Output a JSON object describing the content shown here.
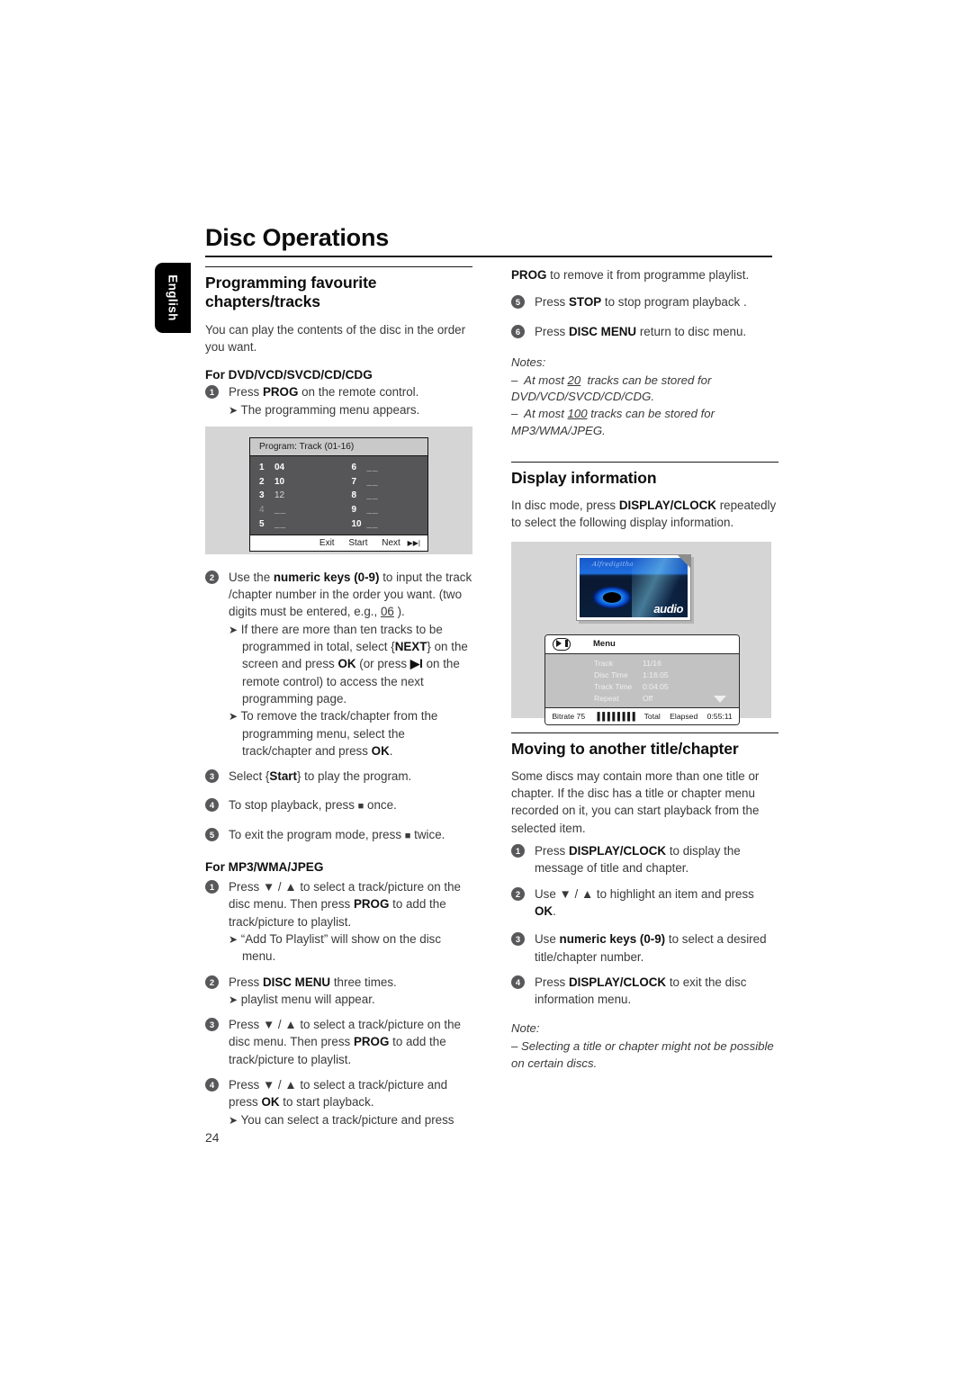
{
  "page": {
    "title": "Disc Operations",
    "language_tab": "English",
    "page_number": "24"
  },
  "left_column": {
    "section_heading": "Programming favourite chapters/tracks",
    "intro": "You can play the contents of the disc in the order you want.",
    "sub_head_1": "For DVD/VCD/SVCD/CD/CDG",
    "steps_dvd": [
      {
        "num": "1",
        "text_parts": [
          "Press ",
          "PROG",
          " on the remote control."
        ],
        "arrows": [
          "The programming menu appears."
        ]
      },
      {
        "num": "2",
        "text_parts": [
          "Use the ",
          "numeric keys (0-9)",
          " to input the track /chapter number in the order you want. (two digits must be entered, e.g., ",
          "06",
          " )."
        ],
        "arrows": [
          "If there are more than ten tracks to be programmed in total, select {NEXT} on the screen and press OK (or press ▶I on the remote control) to access the next programming page.",
          "To remove the track/chapter from the programming menu, select the track/chapter and press OK."
        ]
      },
      {
        "num": "3",
        "text_parts": [
          "Select {",
          "Start",
          "} to play the program."
        ],
        "arrows": []
      },
      {
        "num": "4",
        "text_parts": [
          "To stop playback, press ",
          "■",
          " once."
        ],
        "arrows": []
      },
      {
        "num": "5",
        "text_parts": [
          "To exit the program mode, press ",
          "■",
          " twice."
        ],
        "arrows": []
      }
    ],
    "sub_head_2": "For MP3/WMA/JPEG",
    "steps_mp3": [
      {
        "num": "1",
        "text_parts": [
          "Press ▼ / ▲ to select a track/picture on the disc menu. Then press ",
          "PROG",
          " to add the track/picture to playlist."
        ],
        "arrows": [
          "“Add To Playlist” will show on the disc menu."
        ]
      },
      {
        "num": "2",
        "text_parts": [
          "Press ",
          "DISC MENU",
          " three times."
        ],
        "arrows": [
          "playlist menu will appear."
        ]
      },
      {
        "num": "3",
        "text_parts": [
          "Press ▼ / ▲ to select a track/picture on the disc menu. Then press ",
          "PROG",
          " to add the track/picture to playlist."
        ],
        "arrows": []
      },
      {
        "num": "4",
        "text_parts": [
          "Press ▼ / ▲ to select a track/picture and press ",
          "OK",
          " to start playback."
        ],
        "arrows": [
          "You can select a track/picture and press"
        ]
      }
    ]
  },
  "program_osd": {
    "title": "Program: Track (01-16)",
    "entries_left": [
      {
        "index": "1",
        "value": "04",
        "style": "bold"
      },
      {
        "index": "2",
        "value": "10",
        "style": "bold"
      },
      {
        "index": "3",
        "value": "12",
        "style": "plain"
      },
      {
        "index": "4",
        "value": "__",
        "style": "blank"
      },
      {
        "index": "5",
        "value": "__",
        "style": "blank"
      }
    ],
    "entries_right": [
      {
        "index": "6",
        "value": "__",
        "style": "blank"
      },
      {
        "index": "7",
        "value": "__",
        "style": "blank"
      },
      {
        "index": "8",
        "value": "__",
        "style": "blank"
      },
      {
        "index": "9",
        "value": "__",
        "style": "blank"
      },
      {
        "index": "10",
        "value": "__",
        "style": "blank"
      }
    ],
    "footer": {
      "exit": "Exit",
      "start": "Start",
      "next": "Next",
      "next_icon": "▶▶|"
    }
  },
  "right_column": {
    "continuation": {
      "text_parts": [
        "PROG",
        " to remove it from programme playlist."
      ]
    },
    "steps_top": [
      {
        "num": "5",
        "text_parts": [
          "Press ",
          "STOP",
          " to stop program playback ."
        ]
      },
      {
        "num": "6",
        "text_parts": [
          "Press ",
          "DISC MENU",
          " return to disc menu."
        ]
      }
    ],
    "notes_label": "Notes:",
    "notes": [
      "–  At most 20  tracks can be stored for DVD/VCD/SVCD/CD/CDG.",
      "–  At most 100 tracks can be stored for MP3/WMA/JPEG."
    ],
    "note_values": {
      "dvd_limit": "20",
      "mp3_limit": "100"
    },
    "display_info": {
      "heading": "Display information",
      "body_parts": [
        "In disc mode, press ",
        "DISPLAY/CLOCK",
        " repeatedly to select the following display information."
      ]
    },
    "moving": {
      "heading": "Moving to another title/chapter",
      "intro": "Some discs may contain more than one title or chapter. If the disc has a title or chapter menu recorded on it, you can start playback from the selected item.",
      "steps": [
        {
          "num": "1",
          "text_parts": [
            "Press ",
            "DISPLAY/CLOCK",
            " to display the message of title and chapter."
          ]
        },
        {
          "num": "2",
          "text_parts": [
            "Use ▼ / ▲ to highlight an item and press ",
            "OK",
            "."
          ]
        },
        {
          "num": "3",
          "text_parts": [
            "Use ",
            "numeric keys (0-9)",
            " to select a desired title/chapter number."
          ]
        },
        {
          "num": "4",
          "text_parts": [
            "Press ",
            "DISPLAY/CLOCK",
            " to exit the disc information menu."
          ]
        }
      ],
      "note_label": "Note:",
      "note": "–  Selecting a title or chapter might not be possible on certain discs."
    }
  },
  "display_osd": {
    "disc_art": {
      "script_text": "Alfredigitha",
      "word": "audio"
    },
    "menu_label": "Menu",
    "rows": [
      {
        "key": "Track",
        "value": "11/16"
      },
      {
        "key": "Disc Time",
        "value": "1:16:05"
      },
      {
        "key": "Track Time",
        "value": "0:04:05"
      },
      {
        "key": "Repeat",
        "value": "Off"
      }
    ],
    "footer": {
      "bitrate_label": "Bitrate 75",
      "bitrate_bars": "▐▐▐▐▐▐▐▐",
      "total": "Total",
      "elapsed": "Elapsed",
      "time": "0:55:11"
    }
  },
  "colors": {
    "text": "#3a3a3a",
    "heading": "#0d0d0d",
    "step_bullet": "#58585b",
    "figure_bg": "#d5d5d5",
    "osd_dark": "#565658"
  }
}
